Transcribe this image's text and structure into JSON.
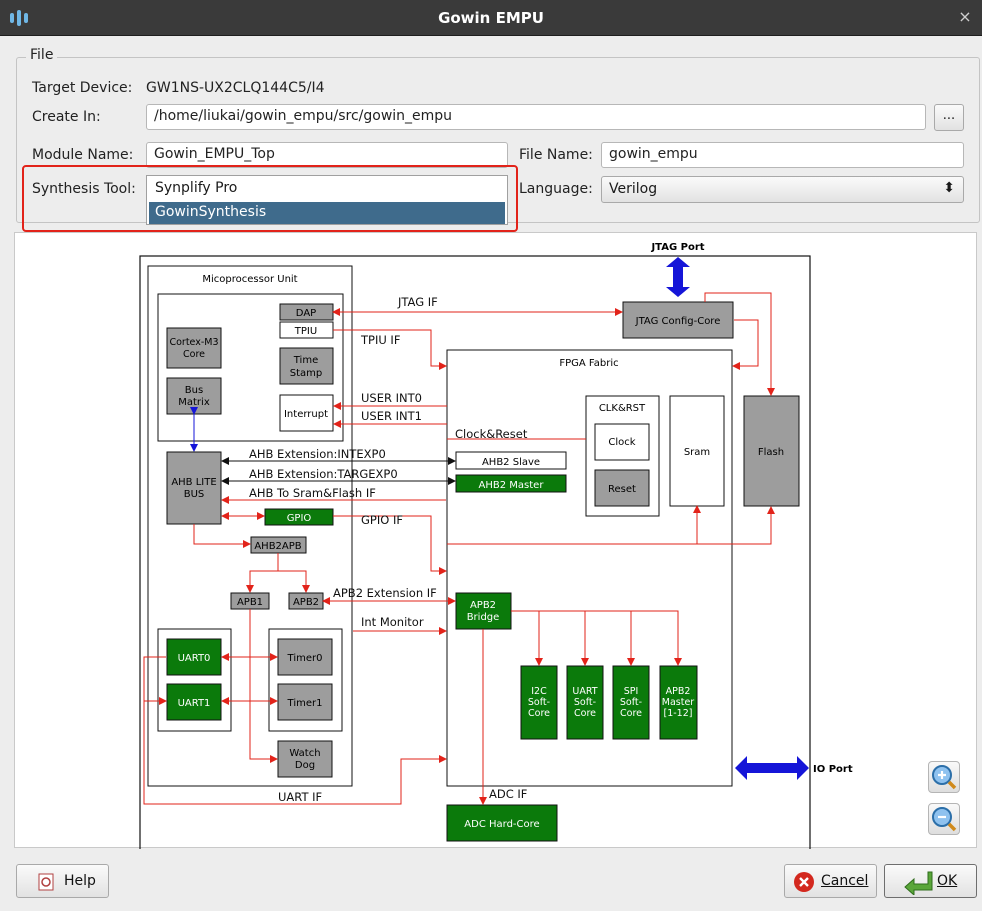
{
  "window": {
    "title": "Gowin EMPU",
    "close_glyph": "×"
  },
  "file_section": {
    "legend": "File",
    "target_device_label": "Target Device:",
    "target_device_value": "GW1NS-UX2CLQ144C5/I4",
    "create_in_label": "Create In:",
    "create_in_value": "/home/liukai/gowin_empu/src/gowin_empu",
    "browse_label": "...",
    "module_name_label": "Module Name:",
    "module_name_value": "Gowin_EMPU_Top",
    "file_name_label": "File Name:",
    "file_name_value": "gowin_empu",
    "synthesis_tool_label": "Synthesis Tool:",
    "synthesis_options": [
      "Synplify Pro",
      "GowinSynthesis"
    ],
    "synthesis_highlighted": "GowinSynthesis",
    "language_label": "Language:",
    "language_value": "Verilog",
    "language_arrows": "⬍"
  },
  "diagram": {
    "jtag_port": "JTAG Port",
    "io_port": "IO Port",
    "mpu_title": "Micoprocessor Unit",
    "dap": "DAP",
    "tpiu": "TPIU",
    "cortex": [
      "Cortex-M3",
      "Core"
    ],
    "time_stamp": [
      "Time",
      "Stamp"
    ],
    "bus_matrix": [
      "Bus",
      "Matrix"
    ],
    "interrupt": "Interrupt",
    "ahb_lite": [
      "AHB LITE",
      "BUS"
    ],
    "gpio": "GPIO",
    "ahb2apb": "AHB2APB",
    "apb1": "APB1",
    "apb2": "APB2",
    "uart0": "UART0",
    "uart1": "UART1",
    "timer0": "Timer0",
    "timer1": "Timer1",
    "watchdog": [
      "Watch",
      "Dog"
    ],
    "jtag_config": "JTAG Config-Core",
    "fpga_fabric": "FPGA Fabric",
    "clk_rst": "CLK&RST",
    "clock": "Clock",
    "reset": "Reset",
    "sram": "Sram",
    "flash": "Flash",
    "ahb2_slave": "AHB2 Slave",
    "ahb2_master": "AHB2 Master",
    "apb2_bridge": [
      "APB2",
      "Bridge"
    ],
    "i2c": [
      "I2C",
      "Soft-",
      "Core"
    ],
    "uart_soft": [
      "UART",
      "Soft-",
      "Core"
    ],
    "spi": [
      "SPI",
      "Soft-",
      "Core"
    ],
    "apb2_master": [
      "APB2",
      "Master",
      "[1-12]"
    ],
    "adc": "ADC Hard-Core",
    "labels": {
      "jtag_if": "JTAG IF",
      "tpiu_if": "TPIU IF",
      "user_int0": "USER INT0",
      "user_int1": "USER INT1",
      "clock_reset": "Clock&Reset",
      "ahb_ext_int": "AHB Extension:INTEXP0",
      "ahb_ext_targ": "AHB Extension:TARGEXP0",
      "ahb_sram": "AHB To Sram&Flash IF",
      "gpio_if": "GPIO IF",
      "apb2_ext": "APB2 Extension IF",
      "int_monitor": "Int Monitor",
      "uart_if": "UART IF",
      "adc_if": "ADC IF"
    }
  },
  "buttons": {
    "help": "Help",
    "cancel": "Cancel",
    "ok": "OK"
  },
  "colors": {
    "accent_red": "#e2231a",
    "green": "#0b7a0b",
    "blue": "#1515d8",
    "gray_block": "#9d9d9d",
    "selection": "#3f6b8c"
  },
  "icons": [
    "gowin-app-icon",
    "close-icon",
    "zoom-in-icon",
    "zoom-out-icon",
    "help-icon",
    "cancel-icon",
    "ok-icon"
  ]
}
